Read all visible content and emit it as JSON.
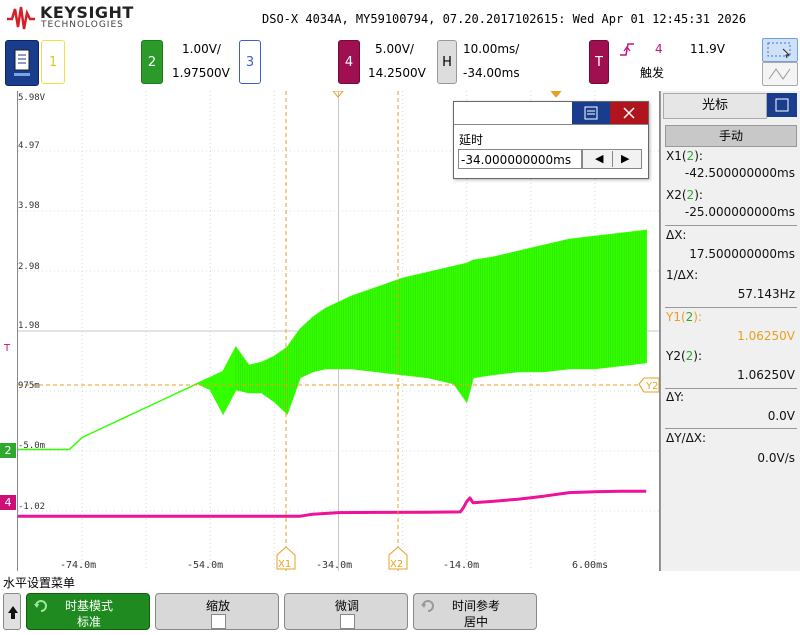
{
  "header": {
    "brand": "KEYSIGHT",
    "brand_sub": "TECHNOLOGIES",
    "title": "DSO-X 4034A, MY59100794, 07.20.2017102615: Wed Apr 01 12:45:31 2026"
  },
  "channels": {
    "ch1": {
      "num": "1",
      "color": "#f0e040"
    },
    "ch2": {
      "num": "2",
      "scale": "1.00V/",
      "offset": "1.97500V",
      "color": "#2fa82f"
    },
    "ch3": {
      "num": "3",
      "color": "#4060c0"
    },
    "ch4": {
      "num": "4",
      "scale": "5.00V/",
      "offset": "14.2500V",
      "color": "#b01060"
    },
    "horizontal": {
      "key": "H",
      "scale": "10.00ms/",
      "position": "-34.00ms"
    },
    "trigger": {
      "key": "T",
      "source": "4",
      "level": "11.9V",
      "mode": "触发",
      "icon": "rising-edge-icon"
    }
  },
  "plot": {
    "y_labels": [
      "5.98V",
      "4.97",
      "3.98",
      "2.98",
      "1.98",
      "975m",
      "-5.0m",
      "-1.02"
    ],
    "x_labels": [
      "-74.0m",
      "-54.0m",
      "-34.0m",
      "-14.0m",
      "6.00ms"
    ],
    "cursor_x1": "X1",
    "cursor_x2": "X2",
    "cursor_y2": "Y2",
    "ch2_marker": "2",
    "ch4_marker": "4",
    "trigger_marker": "T"
  },
  "chart_data": {
    "type": "line",
    "xlabel": "",
    "ylabel": "",
    "xlim": [
      -84,
      16
    ],
    "x_ticks": [
      -74,
      -54,
      -34,
      -14,
      6
    ],
    "series": [
      {
        "name": "2",
        "color": "#33ff00",
        "x": [
          -84,
          -76,
          -74,
          -70,
          -64,
          -60,
          -56,
          -54,
          -52,
          -50,
          -48,
          -46,
          -44,
          -42,
          -40,
          -38,
          -36,
          -34,
          -32,
          -28,
          -24,
          -20,
          -16,
          -14,
          -13,
          -10,
          -6,
          -2,
          2,
          6,
          10,
          14
        ],
        "y_upper": [
          0.0,
          0.0,
          0.2,
          0.4,
          0.7,
          0.9,
          1.1,
          1.2,
          1.3,
          1.7,
          1.4,
          1.45,
          1.55,
          1.7,
          2.0,
          2.2,
          2.35,
          2.45,
          2.55,
          2.7,
          2.85,
          2.95,
          3.05,
          3.1,
          3.15,
          3.2,
          3.3,
          3.4,
          3.5,
          3.55,
          3.6,
          3.65
        ],
        "y_lower": [
          0.0,
          0.0,
          0.2,
          0.4,
          0.7,
          0.9,
          1.1,
          1.0,
          0.6,
          1.0,
          0.95,
          0.95,
          0.8,
          0.6,
          1.2,
          1.3,
          1.35,
          1.35,
          1.35,
          1.3,
          1.25,
          1.2,
          1.1,
          0.8,
          1.2,
          1.25,
          1.3,
          1.3,
          1.35,
          1.35,
          1.4,
          1.45
        ]
      },
      {
        "name": "4",
        "color": "#ee1199",
        "x": [
          -84,
          -54,
          -44,
          -40,
          -38,
          -34,
          -28,
          -20,
          -15,
          -14.5,
          -14,
          -13.5,
          -13,
          -10,
          -6,
          -2,
          2,
          6,
          10,
          14
        ],
        "y": [
          -1.02,
          -1.02,
          -1.02,
          -1.02,
          -0.85,
          -0.72,
          -0.7,
          -0.68,
          -0.66,
          -0.3,
          0.2,
          0.5,
          0.1,
          0.22,
          0.4,
          0.65,
          0.95,
          1.02,
          1.06,
          1.06
        ]
      }
    ]
  },
  "cursor_panel": {
    "title": "光标",
    "mode_button": "手动",
    "x1_label": "X1(2):",
    "x1_value": "-42.500000000ms",
    "x2_label": "X2(2):",
    "x2_value": "-25.000000000ms",
    "dx_label": "ΔX:",
    "dx_value": "17.500000000ms",
    "inv_dx_label": "1/ΔX:",
    "inv_dx_value": "57.143Hz",
    "y1_label": "Y1(2):",
    "y1_value": "1.06250V",
    "y2_label": "Y2(2):",
    "y2_value": "1.06250V",
    "dy_label": "ΔY:",
    "dy_value": "0.0V",
    "dydx_label": "ΔY/ΔX:",
    "dydx_value": "0.0V/s"
  },
  "delay_dialog": {
    "label": "延时",
    "value": "-34.000000000ms"
  },
  "menu": {
    "title": "水平设置菜单",
    "softkeys": [
      {
        "label": "时基模式",
        "value": "标准"
      },
      {
        "label": "缩放",
        "value": ""
      },
      {
        "label": "微调",
        "value": ""
      },
      {
        "label": "时间参考",
        "value": "居中"
      }
    ]
  }
}
